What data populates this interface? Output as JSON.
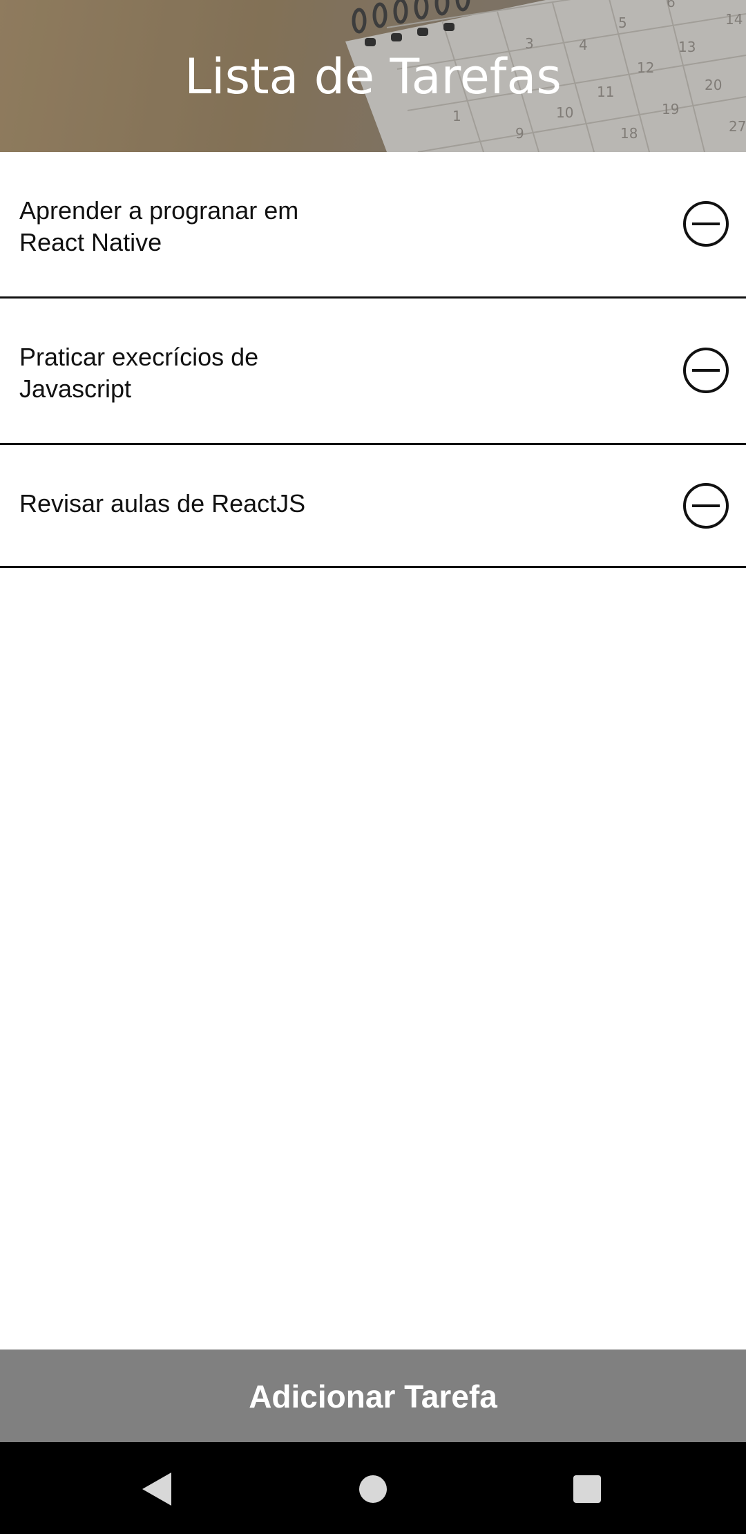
{
  "header": {
    "title": "Lista de Tarefas"
  },
  "tasks": [
    {
      "text": "Aprender a progranar em React Native",
      "line1": "Aprender a progranar em",
      "line2": "React Native",
      "remove_icon": "minus-circle-icon"
    },
    {
      "text": "Praticar execrícios de Javascript",
      "line1": "Praticar execrícios de",
      "line2": "Javascript",
      "remove_icon": "minus-circle-icon"
    },
    {
      "text": "Revisar aulas de ReactJS",
      "line1": "Revisar aulas de ReactJS",
      "line2": "",
      "remove_icon": "minus-circle-icon"
    }
  ],
  "add_button": {
    "label": "Adicionar Tarefa"
  },
  "nav": {
    "back_icon": "back-triangle-icon",
    "home_icon": "home-circle-icon",
    "recents_icon": "recents-square-icon"
  },
  "colors": {
    "button_bg": "#808080",
    "divider": "#111111",
    "nav_bg": "#000000",
    "title_text": "#ffffff"
  }
}
